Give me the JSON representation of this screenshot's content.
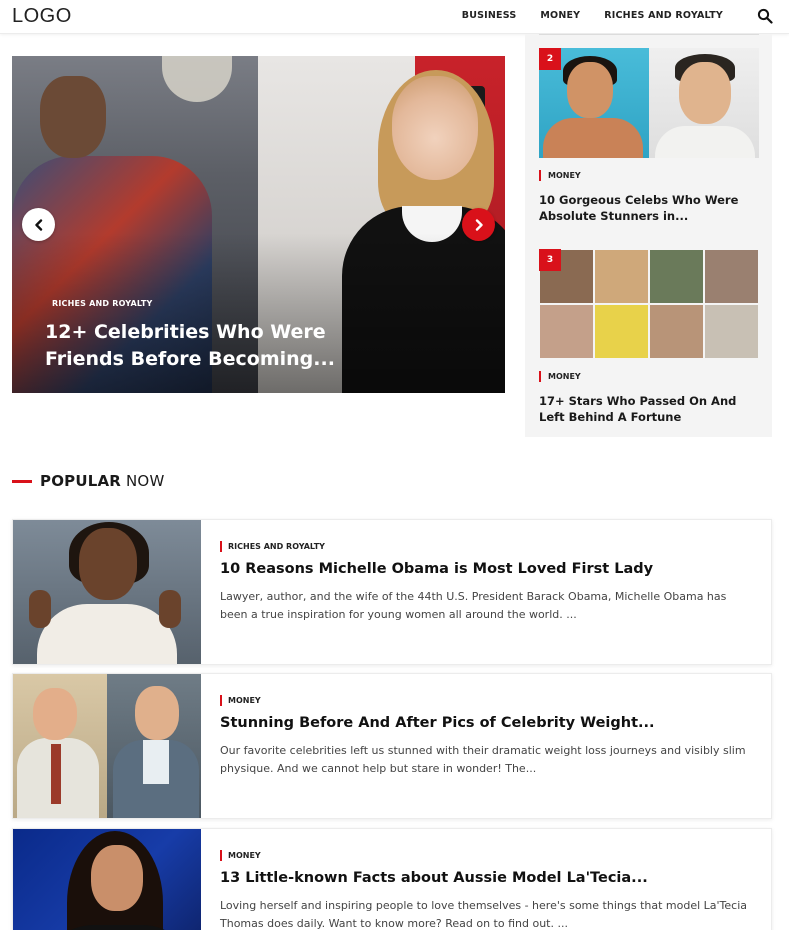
{
  "header": {
    "logo": "LOGO",
    "nav": [
      {
        "label": "BUSINESS"
      },
      {
        "label": "MONEY"
      },
      {
        "label": "RICHES AND ROYALTY"
      }
    ]
  },
  "hero": {
    "category": "RICHES AND ROYALTY",
    "title": "12+ Celebrities Who Were Friends Before Becoming..."
  },
  "sidebar": {
    "items": [
      {
        "number": "2",
        "category": "MONEY",
        "title": "10 Gorgeous Celebs Who Were Absolute Stunners in..."
      },
      {
        "number": "3",
        "category": "MONEY",
        "title": "17+ Stars Who Passed On And Left Behind A Fortune"
      }
    ]
  },
  "popular": {
    "heading_bold": "POPULAR",
    "heading_rest": " NOW",
    "items": [
      {
        "category": "RICHES AND ROYALTY",
        "title": "10 Reasons Michelle Obama is Most Loved First Lady",
        "description": "Lawyer, author, and the wife of the 44th U.S. President Barack Obama, Michelle Obama has been a true inspiration for young women all around the world. ..."
      },
      {
        "category": "MONEY",
        "title": "Stunning Before And After Pics of Celebrity Weight...",
        "description": "Our favorite celebrities left us stunned with their dramatic weight loss journeys and visibly slim physique. And we cannot help but stare in wonder! The..."
      },
      {
        "category": "MONEY",
        "title": "13 Little-known Facts about Aussie Model La'Tecia...",
        "description": "Loving herself and inspiring people to love themselves - here's some things that model La'Tecia Thomas does daily. Want to know more? Read on to find out. ..."
      }
    ]
  },
  "icons": {
    "search": "search-icon",
    "prev": "chevron-left-icon",
    "next": "chevron-right-icon"
  },
  "colors": {
    "accent": "#d9111a"
  }
}
